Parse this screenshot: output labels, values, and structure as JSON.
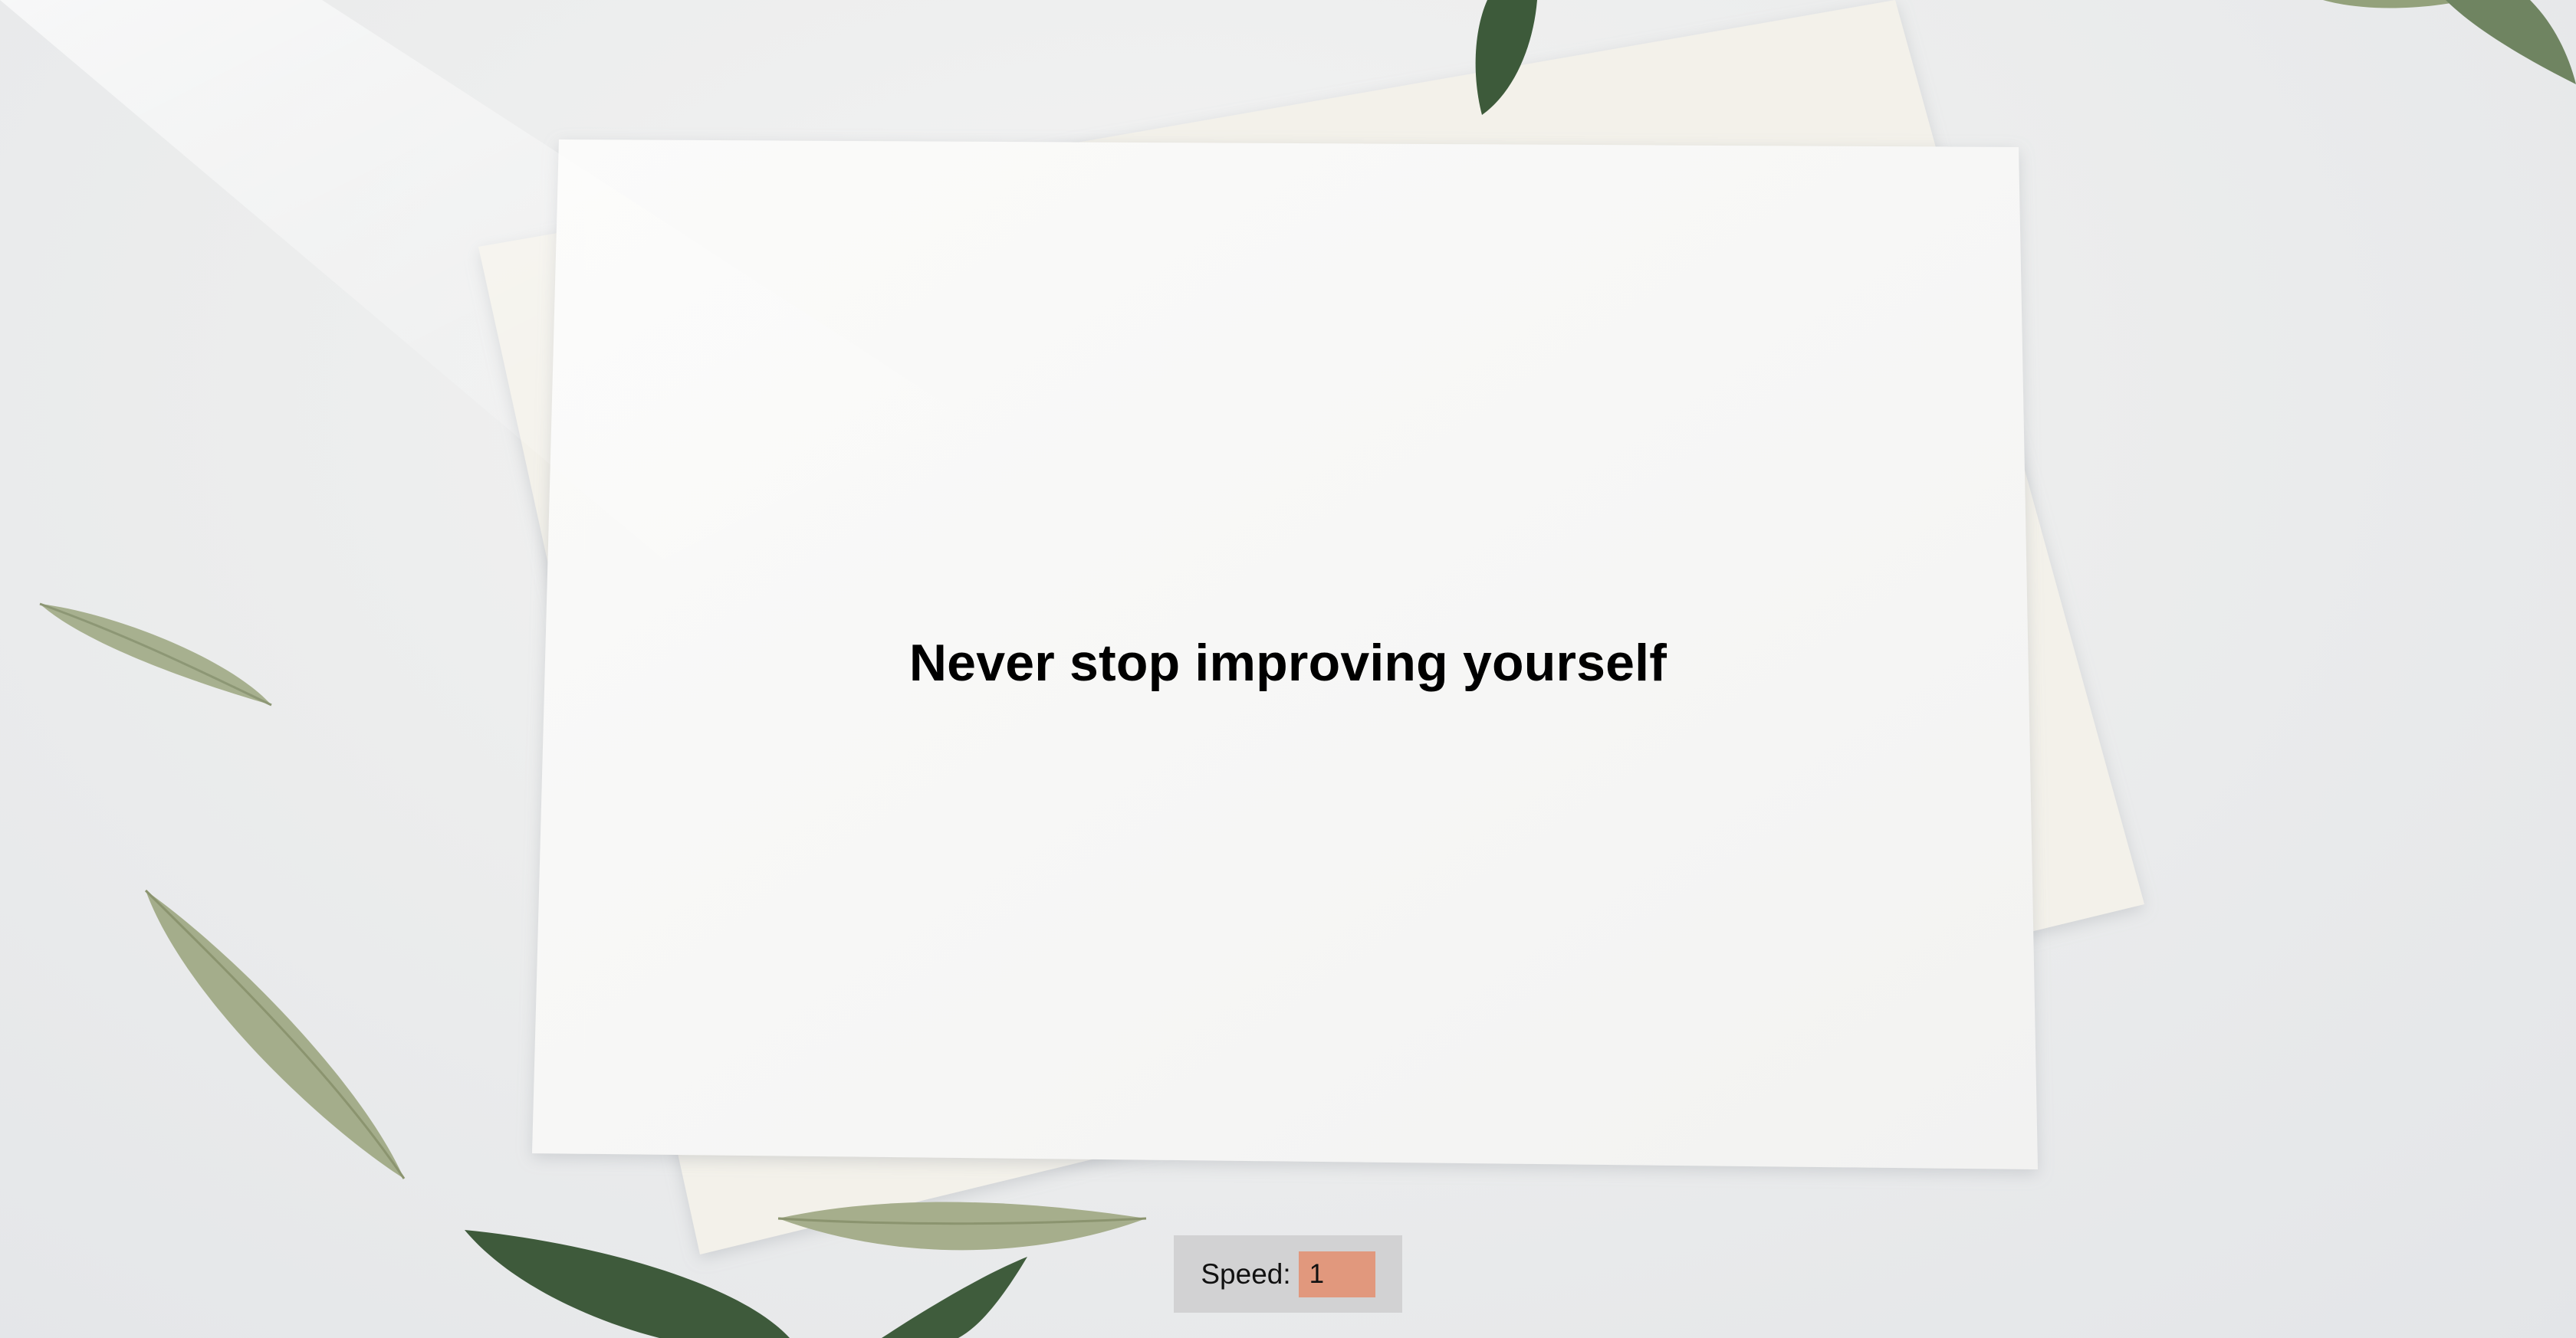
{
  "card": {
    "headline": "Never stop improving yourself"
  },
  "speed_control": {
    "label": "Speed:",
    "value": "1"
  },
  "colors": {
    "background": "#e7e8ea",
    "card": "#f7f7f6",
    "envelope": "#f3f1ea",
    "leaf_light": "#a7b08f",
    "leaf_dark": "#3e5a3b",
    "speed_panel": "#d2d2d3",
    "speed_input": "#e1987d"
  }
}
